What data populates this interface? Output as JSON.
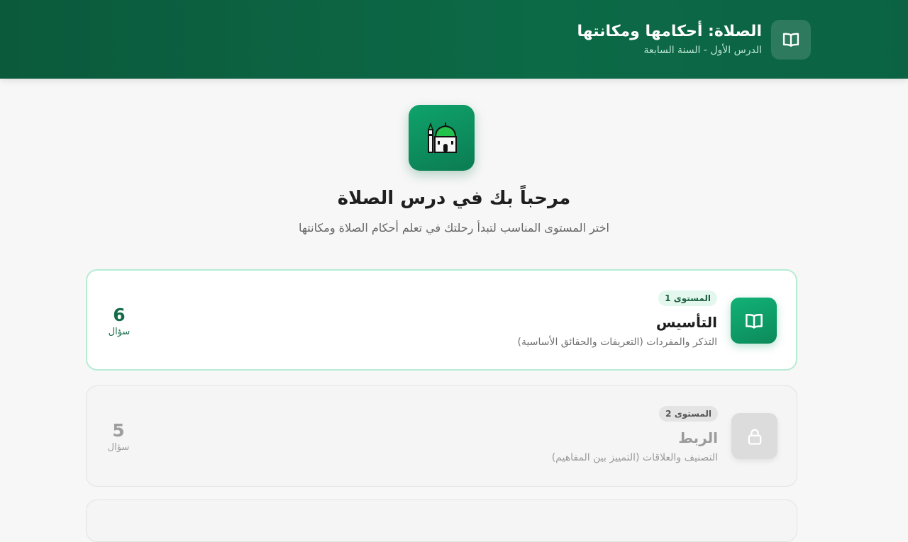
{
  "header": {
    "title": "الصلاة: أحكامها ومكانتها",
    "subtitle": "الدرس الأول - السنة السابعة",
    "icon": "open-book-icon"
  },
  "hero": {
    "icon": "mosque-icon",
    "title": "مرحباً بك في درس الصلاة",
    "subtitle": "اختر المستوى المناسب لتبدأ رحلتك في تعلم أحكام الصلاة ومكانتها"
  },
  "levels": [
    {
      "badge": "المستوى 1",
      "title": "التأسيس",
      "description": "التذكر والمفردات (التعريفات والحقائق الأساسية)",
      "count": "6",
      "count_label": "سؤال",
      "icon": "open-book-icon",
      "state": "unlocked"
    },
    {
      "badge": "المستوى 2",
      "title": "الربط",
      "description": "التصنيف والعلاقات (التمييز بين المفاهيم)",
      "count": "5",
      "count_label": "سؤال",
      "icon": "lock-icon",
      "state": "locked"
    }
  ],
  "colors": {
    "header_bg": "#0b5f40",
    "accent": "#10a06b",
    "accent_dark": "#146c48",
    "locked_gray": "#9e9e9e"
  }
}
